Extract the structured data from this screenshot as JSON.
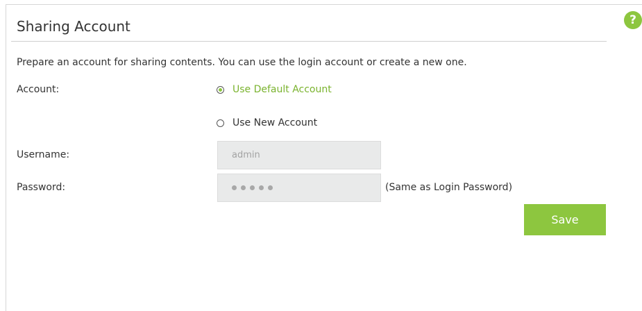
{
  "section": {
    "title": "Sharing Account",
    "help_glyph": "?",
    "description": "Prepare an account for sharing contents. You can use the login account or create a new one."
  },
  "form": {
    "account_label": "Account:",
    "options": [
      {
        "label": "Use Default Account",
        "selected": true
      },
      {
        "label": "Use New Account",
        "selected": false
      }
    ],
    "username_label": "Username:",
    "username_value": "admin",
    "password_label": "Password:",
    "password_mask_length": 5,
    "password_note": "(Same as Login Password)",
    "save_label": "Save"
  },
  "colors": {
    "accent": "#8dc63f",
    "selected_text": "#7ab32e",
    "field_bg": "#e9eaea"
  },
  "icons": {
    "help": "help-icon"
  }
}
